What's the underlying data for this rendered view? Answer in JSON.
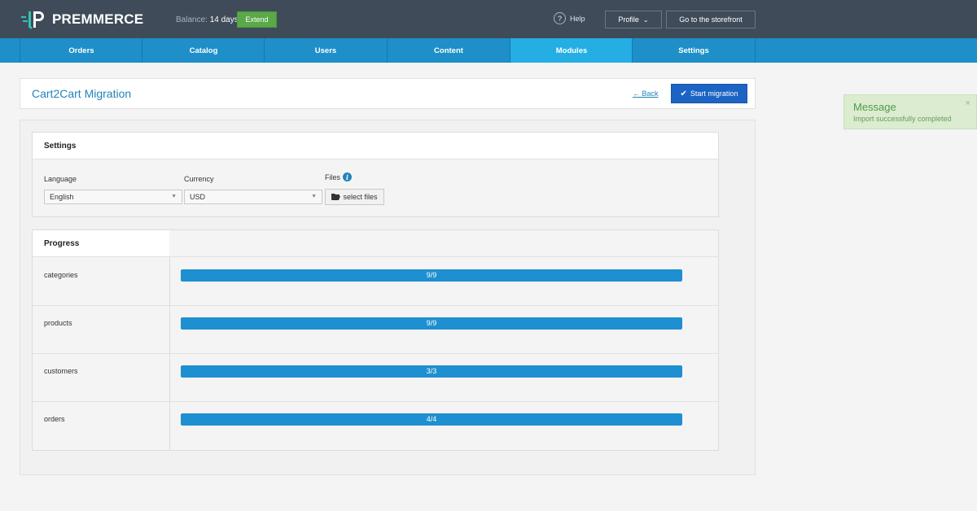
{
  "topbar": {
    "logo_text": "PREMMERCE",
    "balance_label": "Balance:",
    "balance_value": "14 days",
    "extend_label": "Extend",
    "help_label": "Help",
    "profile_label": "Profile",
    "storefront_label": "Go to the storefront"
  },
  "nav": {
    "items": [
      {
        "label": "Orders"
      },
      {
        "label": "Catalog"
      },
      {
        "label": "Users"
      },
      {
        "label": "Content"
      },
      {
        "label": "Modules",
        "active": true
      },
      {
        "label": "Settings"
      }
    ]
  },
  "header": {
    "title": "Cart2Cart Migration",
    "back_label": "← Back",
    "start_label": "Start migration"
  },
  "settings": {
    "title": "Settings",
    "language_label": "Language",
    "language_value": "English",
    "currency_label": "Currency",
    "currency_value": "USD",
    "files_label": "Files",
    "files_button": "select files"
  },
  "progress": {
    "title": "Progress",
    "rows": [
      {
        "label": "categories",
        "text": "9/9",
        "fraction": 1.0
      },
      {
        "label": "products",
        "text": "9/9",
        "fraction": 1.0
      },
      {
        "label": "customers",
        "text": "3/3",
        "fraction": 1.0
      },
      {
        "label": "orders",
        "text": "4/4",
        "fraction": 1.0
      }
    ]
  },
  "toast": {
    "title": "Message",
    "text": "Import successfully completed",
    "close_glyph": "×"
  },
  "colors": {
    "topbar": "#3f4b59",
    "nav": "#1e8fc8",
    "nav_active": "#24aee4",
    "accent": "#1f84ba",
    "primary_button": "#1c64c4",
    "success": "#5aa848",
    "progress_fill": "#1e8fd0"
  }
}
